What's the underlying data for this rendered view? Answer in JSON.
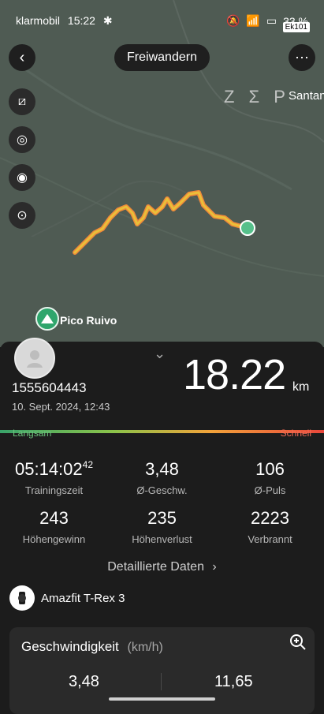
{
  "status_bar": {
    "carrier": "klarmobil",
    "time": "15:22",
    "battery": "33 %",
    "notice": "Ek101"
  },
  "header": {
    "activity": "Freiwandern"
  },
  "map": {
    "watermark": "Z Σ P",
    "place_label_top_right": "Santan",
    "poi_label": "Pico Ruivo"
  },
  "summary": {
    "user_id": "1555604443",
    "date": "10. Sept. 2024, 12:43",
    "distance": "18.22",
    "distance_unit": "km",
    "speed_scale": {
      "slow": "Langsam",
      "fast": "Schnell"
    }
  },
  "stats": [
    {
      "value": "05:14:02",
      "value_sup": "42",
      "label": "Trainingszeit"
    },
    {
      "value": "3,48",
      "label": "Ø-Geschw."
    },
    {
      "value": "106",
      "label": "Ø-Puls"
    },
    {
      "value": "243",
      "label": "Höhengewinn"
    },
    {
      "value": "235",
      "label": "Höhenverlust"
    },
    {
      "value": "2223",
      "label": "Verbrannt"
    }
  ],
  "details_link": "Detaillierte Daten",
  "device": {
    "name": "Amazfit T-Rex 3"
  },
  "speed_card": {
    "title": "Geschwindigkeit",
    "unit": "(km/h)",
    "avg": "3,48",
    "max": "11,65"
  },
  "colors": {
    "accent_green": "#56c08b",
    "route_yellow": "#e9c43a",
    "route_orange": "#f08a3a",
    "panel": "#1c1c1c"
  }
}
